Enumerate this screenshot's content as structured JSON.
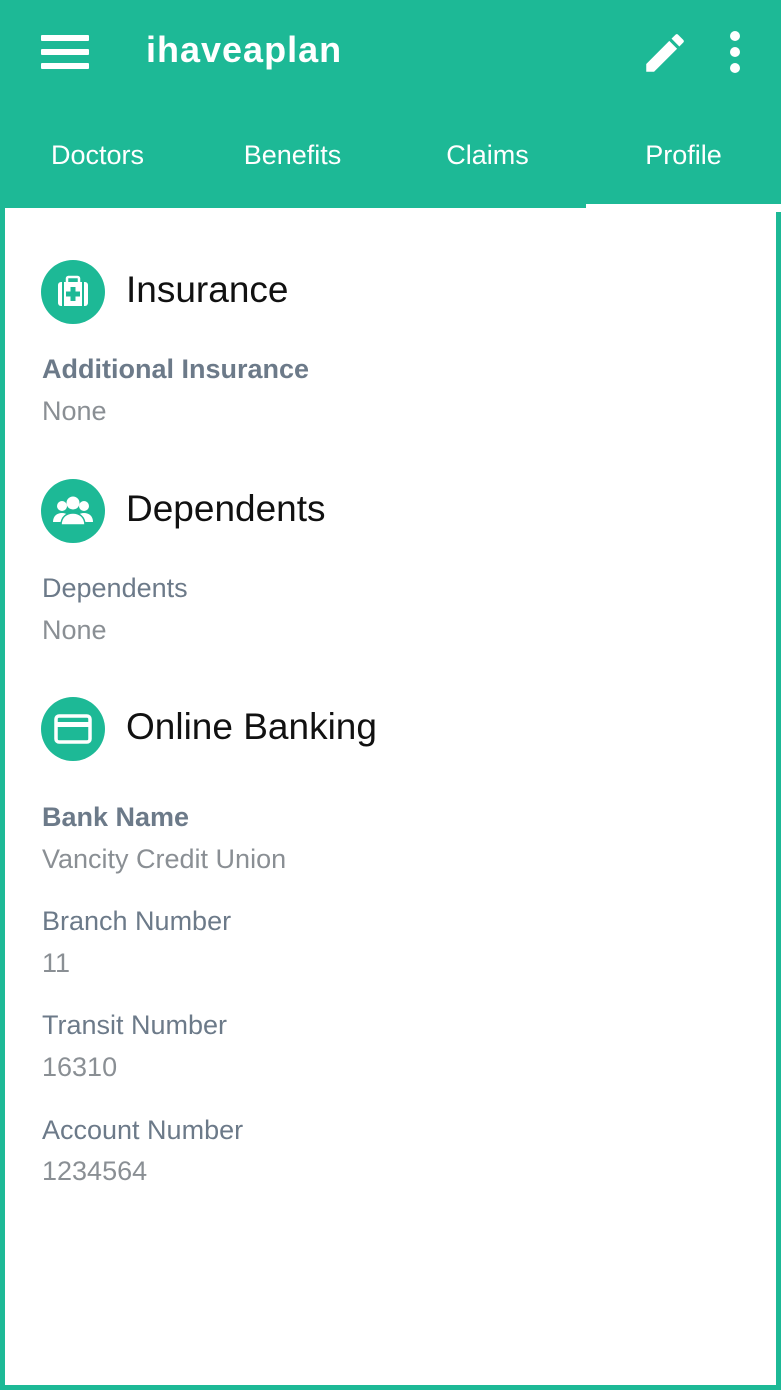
{
  "app": {
    "title": "ihaveaplan"
  },
  "tabs": [
    {
      "label": "Doctors"
    },
    {
      "label": "Benefits"
    },
    {
      "label": "Claims"
    },
    {
      "label": "Profile"
    }
  ],
  "active_tab": "Profile",
  "icons": {
    "menu": "hamburger-menu-icon",
    "edit": "pencil-icon",
    "more": "vertical-dots-icon",
    "insurance": "medical-kit-icon",
    "dependents": "people-group-icon",
    "banking": "credit-card-icon"
  },
  "colors": {
    "accent": "#1db996",
    "label": "#6c7a89",
    "value": "#8a8f94"
  },
  "insurance": {
    "title": "Insurance",
    "fields": [
      {
        "label": "Additional Insurance",
        "value": "None"
      }
    ]
  },
  "dependents": {
    "title": "Dependents",
    "fields": [
      {
        "label": "Dependents",
        "value": "None"
      }
    ]
  },
  "banking": {
    "title": "Online Banking",
    "fields": [
      {
        "label": "Bank Name",
        "value": "Vancity Credit Union"
      },
      {
        "label": "Branch Number",
        "value": "11"
      },
      {
        "label": "Transit Number",
        "value": "16310"
      },
      {
        "label": "Account Number",
        "value": "1234564"
      }
    ]
  }
}
